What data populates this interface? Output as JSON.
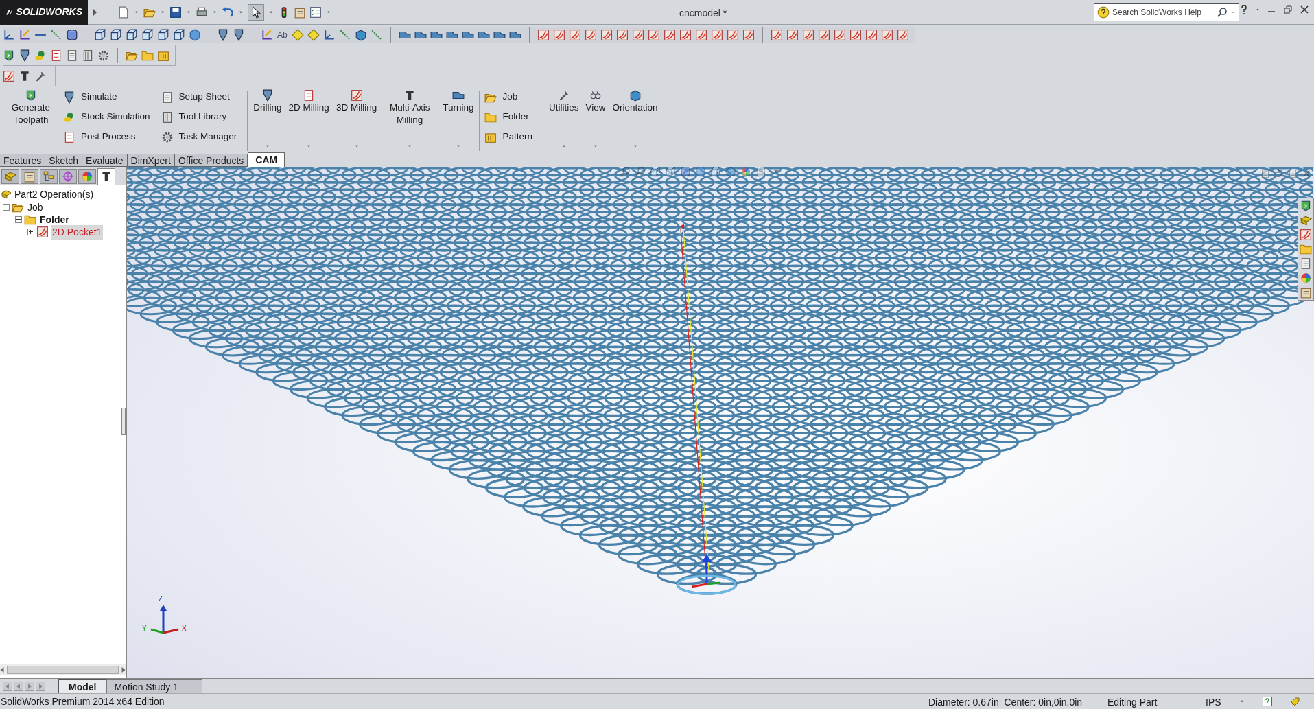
{
  "window": {
    "logo": "SOLIDWORKS",
    "title": "cncmodel *",
    "search": {
      "placeholder": "Search SolidWorks Help"
    }
  },
  "sketch_toolbar": {
    "text_tool": "Ab"
  },
  "ribbon": {
    "groups": [
      {
        "kind": "large",
        "items": [
          {
            "label": "Generate Toolpath",
            "dropdown": false
          }
        ]
      },
      {
        "kind": "stack",
        "items": [
          "Simulate",
          "Stock Simulation",
          "Post Process"
        ]
      },
      {
        "kind": "stack",
        "items": [
          "Setup Sheet",
          "Tool Library",
          "Task Manager"
        ]
      },
      {
        "kind": "large",
        "items": [
          {
            "label": "Drilling",
            "dropdown": true
          },
          {
            "label": "2D Milling",
            "dropdown": true
          },
          {
            "label": "3D Milling",
            "dropdown": true
          },
          {
            "label": "Multi-Axis Milling",
            "dropdown": true
          },
          {
            "label": "Turning",
            "dropdown": true
          }
        ]
      },
      {
        "kind": "stack",
        "items": [
          "Job",
          "Folder",
          "Pattern"
        ]
      },
      {
        "kind": "large",
        "items": [
          {
            "label": "Utilities",
            "dropdown": true
          },
          {
            "label": "View",
            "dropdown": true
          },
          {
            "label": "Orientation",
            "dropdown": true
          }
        ]
      }
    ]
  },
  "command_tabs": [
    {
      "label": "Features",
      "selected": false
    },
    {
      "label": "Sketch",
      "selected": false
    },
    {
      "label": "Evaluate",
      "selected": false
    },
    {
      "label": "DimXpert",
      "selected": false
    },
    {
      "label": "Office Products",
      "selected": false
    },
    {
      "label": "CAM",
      "selected": true
    }
  ],
  "feature_manager_tabs": [
    {
      "selected": false
    },
    {
      "selected": false
    },
    {
      "selected": false
    },
    {
      "selected": false
    },
    {
      "selected": false
    },
    {
      "selected": true
    }
  ],
  "feature_tree": {
    "root": "Part2 Operation(s)",
    "items": [
      {
        "label": "Job",
        "expanded": true,
        "active": false,
        "selected": false,
        "children": [
          {
            "label": "Folder",
            "expanded": true,
            "active": true,
            "selected": false,
            "children": [
              {
                "label": "2D Pocket1",
                "expanded": false,
                "active": false,
                "selected": true
              }
            ]
          }
        ]
      }
    ]
  },
  "triad": {
    "z": "Z",
    "y": "Y",
    "x": "X"
  },
  "model_tabs": [
    {
      "label": "Model",
      "selected": true
    },
    {
      "label": "Motion Study 1",
      "selected": false
    }
  ],
  "status_bar": {
    "edition": "SolidWorks Premium 2014 x64 Edition",
    "measure": "Diameter: 0.67in  Center: 0in,0in,0in",
    "mode": "Editing Part",
    "units": "IPS"
  }
}
